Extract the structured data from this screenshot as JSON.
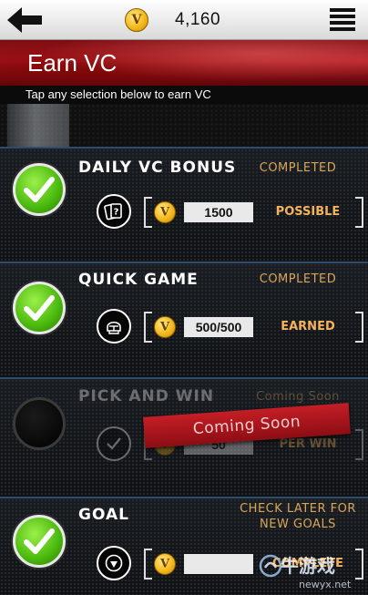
{
  "topbar": {
    "back_icon": "back-arrow-icon",
    "coin_icon": "vc-coin-icon",
    "balance": "4,160",
    "menu_icon": "hamburger-menu-icon"
  },
  "header": {
    "title": "Earn VC",
    "subtitle": "Tap any selection below to earn VC"
  },
  "rows": [
    {
      "title": "DAILY VC BONUS",
      "state": "COMPLETED",
      "detail_icon": "cards-question-icon",
      "value": "1500",
      "reward_status": "POSSIBLE",
      "check": "checkmark-icon"
    },
    {
      "title": "QUICK GAME",
      "state": "COMPLETED",
      "detail_icon": "player-helmet-icon",
      "value": "500/500",
      "reward_status": "EARNED",
      "check": "checkmark-icon"
    },
    {
      "title": "PICK AND WIN",
      "state": "Coming Soon",
      "detail_icon": "checkmark-icon",
      "value": "50",
      "reward_status": "PER WIN",
      "ribbon": "Coming Soon"
    },
    {
      "title": "GOAL",
      "state_line1": "CHECK LATER FOR",
      "state_line2": "NEW GOALS",
      "detail_icon": "basketball-icon",
      "value": "",
      "reward_status": "COMPLETE",
      "check": "checkmark-icon"
    }
  ],
  "watermark": {
    "cn": "牛游戏",
    "url": "newyx.net"
  },
  "colors": {
    "accent_red": "#b01a22",
    "status_orange": "#d8a55a",
    "check_green": "#49b80c",
    "row_divider": "#2c4d6e"
  }
}
